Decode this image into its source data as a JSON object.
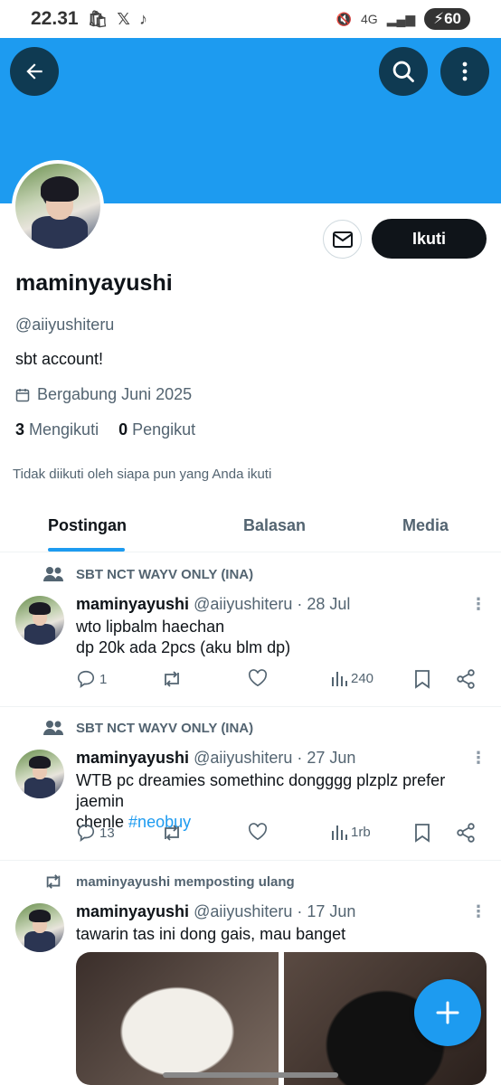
{
  "status_bar": {
    "time": "22.31",
    "network": "4G",
    "battery": "60"
  },
  "profile": {
    "display_name": "maminyayushi",
    "handle": "@aiiyushiteru",
    "bio": "sbt account!",
    "joined": "Bergabung Juni 2025",
    "following_count": "3",
    "following_label": "Mengikuti",
    "followers_count": "0",
    "followers_label": "Pengikut",
    "not_followed_text": "Tidak diikuti oleh siapa pun yang Anda ikuti",
    "follow_button": "Ikuti"
  },
  "tabs": [
    {
      "label": "Postingan",
      "active": true
    },
    {
      "label": "Balasan",
      "active": false
    },
    {
      "label": "Media",
      "active": false
    }
  ],
  "posts": [
    {
      "context": "SBT NCT WAYV ONLY (INA)",
      "name": "maminyayushi",
      "meta": "@aiiyushiteru · 28 Jul",
      "line1": "wto lipbalm haechan",
      "line2": "dp 20k ada 2pcs (aku blm dp)",
      "replies": "1",
      "views": "240"
    },
    {
      "context": "SBT NCT WAYV ONLY (INA)",
      "name": "maminyayushi",
      "meta": "@aiiyushiteru · 27 Jun",
      "line1": "WTB pc dreamies somethinc dongggg plzplz prefer jaemin",
      "line2_prefix": "chenle ",
      "hashtag": "#neobuy",
      "replies": "13",
      "views": "1rb"
    },
    {
      "context": "maminyayushi memposting ulang",
      "name": "maminyayushi",
      "meta": "@aiiyushiteru · 17 Jun",
      "line1": "tawarin tas ini dong gais, mau banget"
    }
  ],
  "colors": {
    "accent": "#1d9bf0",
    "text": "#0f1419",
    "muted": "#536471"
  }
}
